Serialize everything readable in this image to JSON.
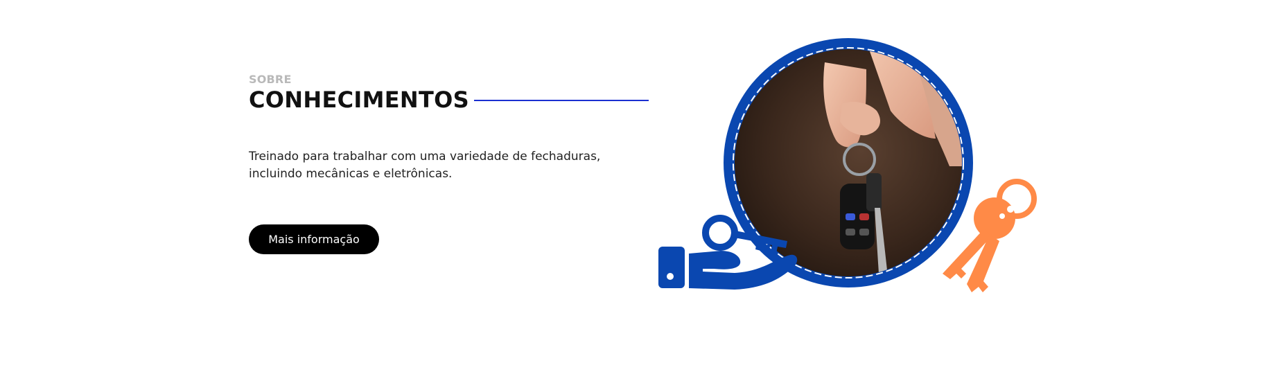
{
  "section": {
    "eyebrow": "SOBRE",
    "title": "CONHECIMENTOS",
    "description": "Treinado para trabalhar com uma variedade de fechaduras, incluindo mecânicas e eletrônicas.",
    "cta_label": "Mais informação"
  },
  "colors": {
    "accent_blue": "#0a47b0",
    "accent_orange": "#ff8a47",
    "title_line": "#1a2fd1",
    "button_bg": "#000000"
  },
  "icons": [
    "hand-key-icon",
    "keyring-icon"
  ]
}
